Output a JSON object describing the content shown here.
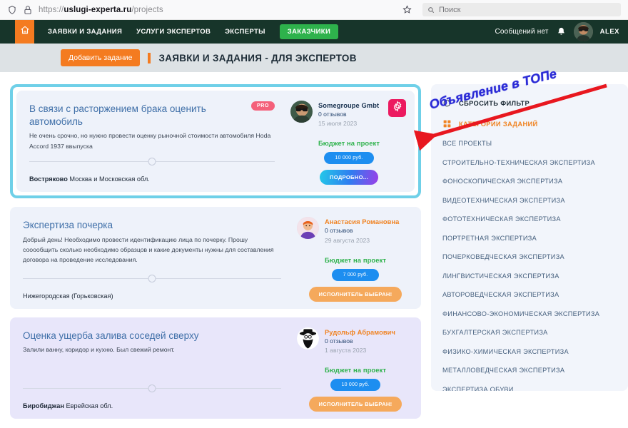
{
  "browser": {
    "url_prefix": "https://",
    "url_domain": "uslugi-experta.ru",
    "url_path": "/projects",
    "search_placeholder": "Поиск",
    "shield_icon": "shield-icon",
    "lock_icon": "lock-icon",
    "star_icon": "bookmark-star-icon",
    "search_icon": "search-icon"
  },
  "topnav": {
    "home_icon": "home-icon",
    "links": [
      {
        "label": "ЗАЯВКИ И ЗАДАНИЯ",
        "style": "plain"
      },
      {
        "label": "УСЛУГИ ЭКСПЕРТОВ",
        "style": "plain"
      },
      {
        "label": "ЭКСПЕРТЫ",
        "style": "plain"
      },
      {
        "label": "ЗАКАЗЧИКИ",
        "style": "pill"
      }
    ],
    "messages": "Сообщений нет",
    "bell_icon": "bell-icon",
    "avatar": "user-avatar",
    "username": "ALEX"
  },
  "page_header": {
    "add_button": "Добавить задание",
    "title": "ЗАЯВКИ И ЗАДАНИЯ - ДЛЯ ЭКСПЕРТОВ"
  },
  "annotation": {
    "text": "Объявление в ТОПе",
    "arrow": "red-arrow-annotation",
    "color": "#2a2ad6"
  },
  "cards": [
    {
      "featured": true,
      "theme": "bg-blue",
      "title": "В связи с расторжением брака оценить автомобиль",
      "desc": "Не очень срочно, но нужно провести оценку рыночной стоимости автомобиля Hoda Accord 1937 ввыпуска",
      "badge": "PRO",
      "city": "Востряково",
      "region": "Москва и Московская обл.",
      "person_name": "Somegroupe Gmbt",
      "person_name_color": "dark",
      "reviews": "0 отзывов",
      "date": "15 июля 2023",
      "gear_icon": "gear-icon",
      "budget_label": "Бюджет на проект",
      "budget_value": "10 000 руб.",
      "action_label": "ПОДРОБНО...",
      "action_type": "details"
    },
    {
      "featured": false,
      "theme": "bg-blue",
      "title": "Экспертиза почерка",
      "desc": "Добрый день! Необходимо провести идентификацию лица по почерку. Прошу сооообщить сколько необходимо образцов и какие документы нужны для составления договора на проведение исследования.",
      "badge": "",
      "city": "",
      "region": "Нижегородская (Горьковская)",
      "person_name": "Анастасия Романовна",
      "person_name_color": "orange",
      "reviews": "0 отзывов",
      "date": "29 августа 2023",
      "gear_icon": "",
      "budget_label": "Бюджет на проект",
      "budget_value": "7 000 руб.",
      "action_label": "ИСПОЛНИТЕЛЬ ВЫБРАН!",
      "action_type": "chosen"
    },
    {
      "featured": false,
      "theme": "bg-lilac",
      "title": "Оценка ущерба залива соседей сверху",
      "desc": "Залили ванну, коридор и кухню. Был свежий ремонт.",
      "badge": "",
      "city": "Биробиджан",
      "region": "Еврейская обл.",
      "person_name": "Рудольф Абрамович",
      "person_name_color": "orange",
      "reviews": "0 отзывов",
      "date": "1 августа 2023",
      "gear_icon": "",
      "budget_label": "Бюджет на проект",
      "budget_value": "10 000 руб.",
      "action_label": "ИСПОЛНИТЕЛЬ ВЫБРАН!",
      "action_type": "chosen"
    }
  ],
  "sidebar": {
    "reset_icon": "refresh-icon",
    "reset_label": "СБРОСИТЬ ФИЛЬТР",
    "categories_icon": "grid-icon",
    "categories_label": "КАТЕГОРИИ ЗАДАНИЙ",
    "items": [
      "ВСЕ ПРОЕКТЫ",
      "СТРОИТЕЛЬНО-ТЕХНИЧЕСКАЯ ЭКСПЕРТИЗА",
      "ФОНОСКОПИЧЕСКАЯ ЭКСПЕРТИЗА",
      "ВИДЕОТЕХНИЧЕСКАЯ ЭКСПЕРТИЗА",
      "ФОТОТЕХНИЧЕСКАЯ ЭКСПЕРТИЗА",
      "ПОРТРЕТНАЯ ЭКСПЕРТИЗА",
      "ПОЧЕРКОВЕДЧЕСКАЯ ЭКСПЕРТИЗА",
      "ЛИНГВИСТИЧЕСКАЯ ЭКСПЕРТИЗА",
      "АВТОРОВЕДЧЕСКАЯ ЭКСПЕРТИЗА",
      "ФИНАНСОВО-ЭКОНОМИЧЕСКАЯ ЭКСПЕРТИЗА",
      "БУХГАЛТЕРСКАЯ ЭКСПЕРТИЗА",
      "ФИЗИКО-ХИМИЧЕСКАЯ ЭКСПЕРТИЗА",
      "МЕТАЛЛОВЕДЧЕСКАЯ ЭКСПЕРТИЗА",
      "ЭКСПЕРТИЗА ОБУВИ"
    ]
  },
  "colors": {
    "brand_orange": "#f47b20",
    "nav_green_dark": "#17352a",
    "pill_green": "#2eb24c",
    "featured_border": "#6fd0e8",
    "pro_pink": "#f4607a",
    "gear_pink": "#ec1a60",
    "budget_blue": "#1d8ef0",
    "chosen_orange": "#f5a95c"
  }
}
